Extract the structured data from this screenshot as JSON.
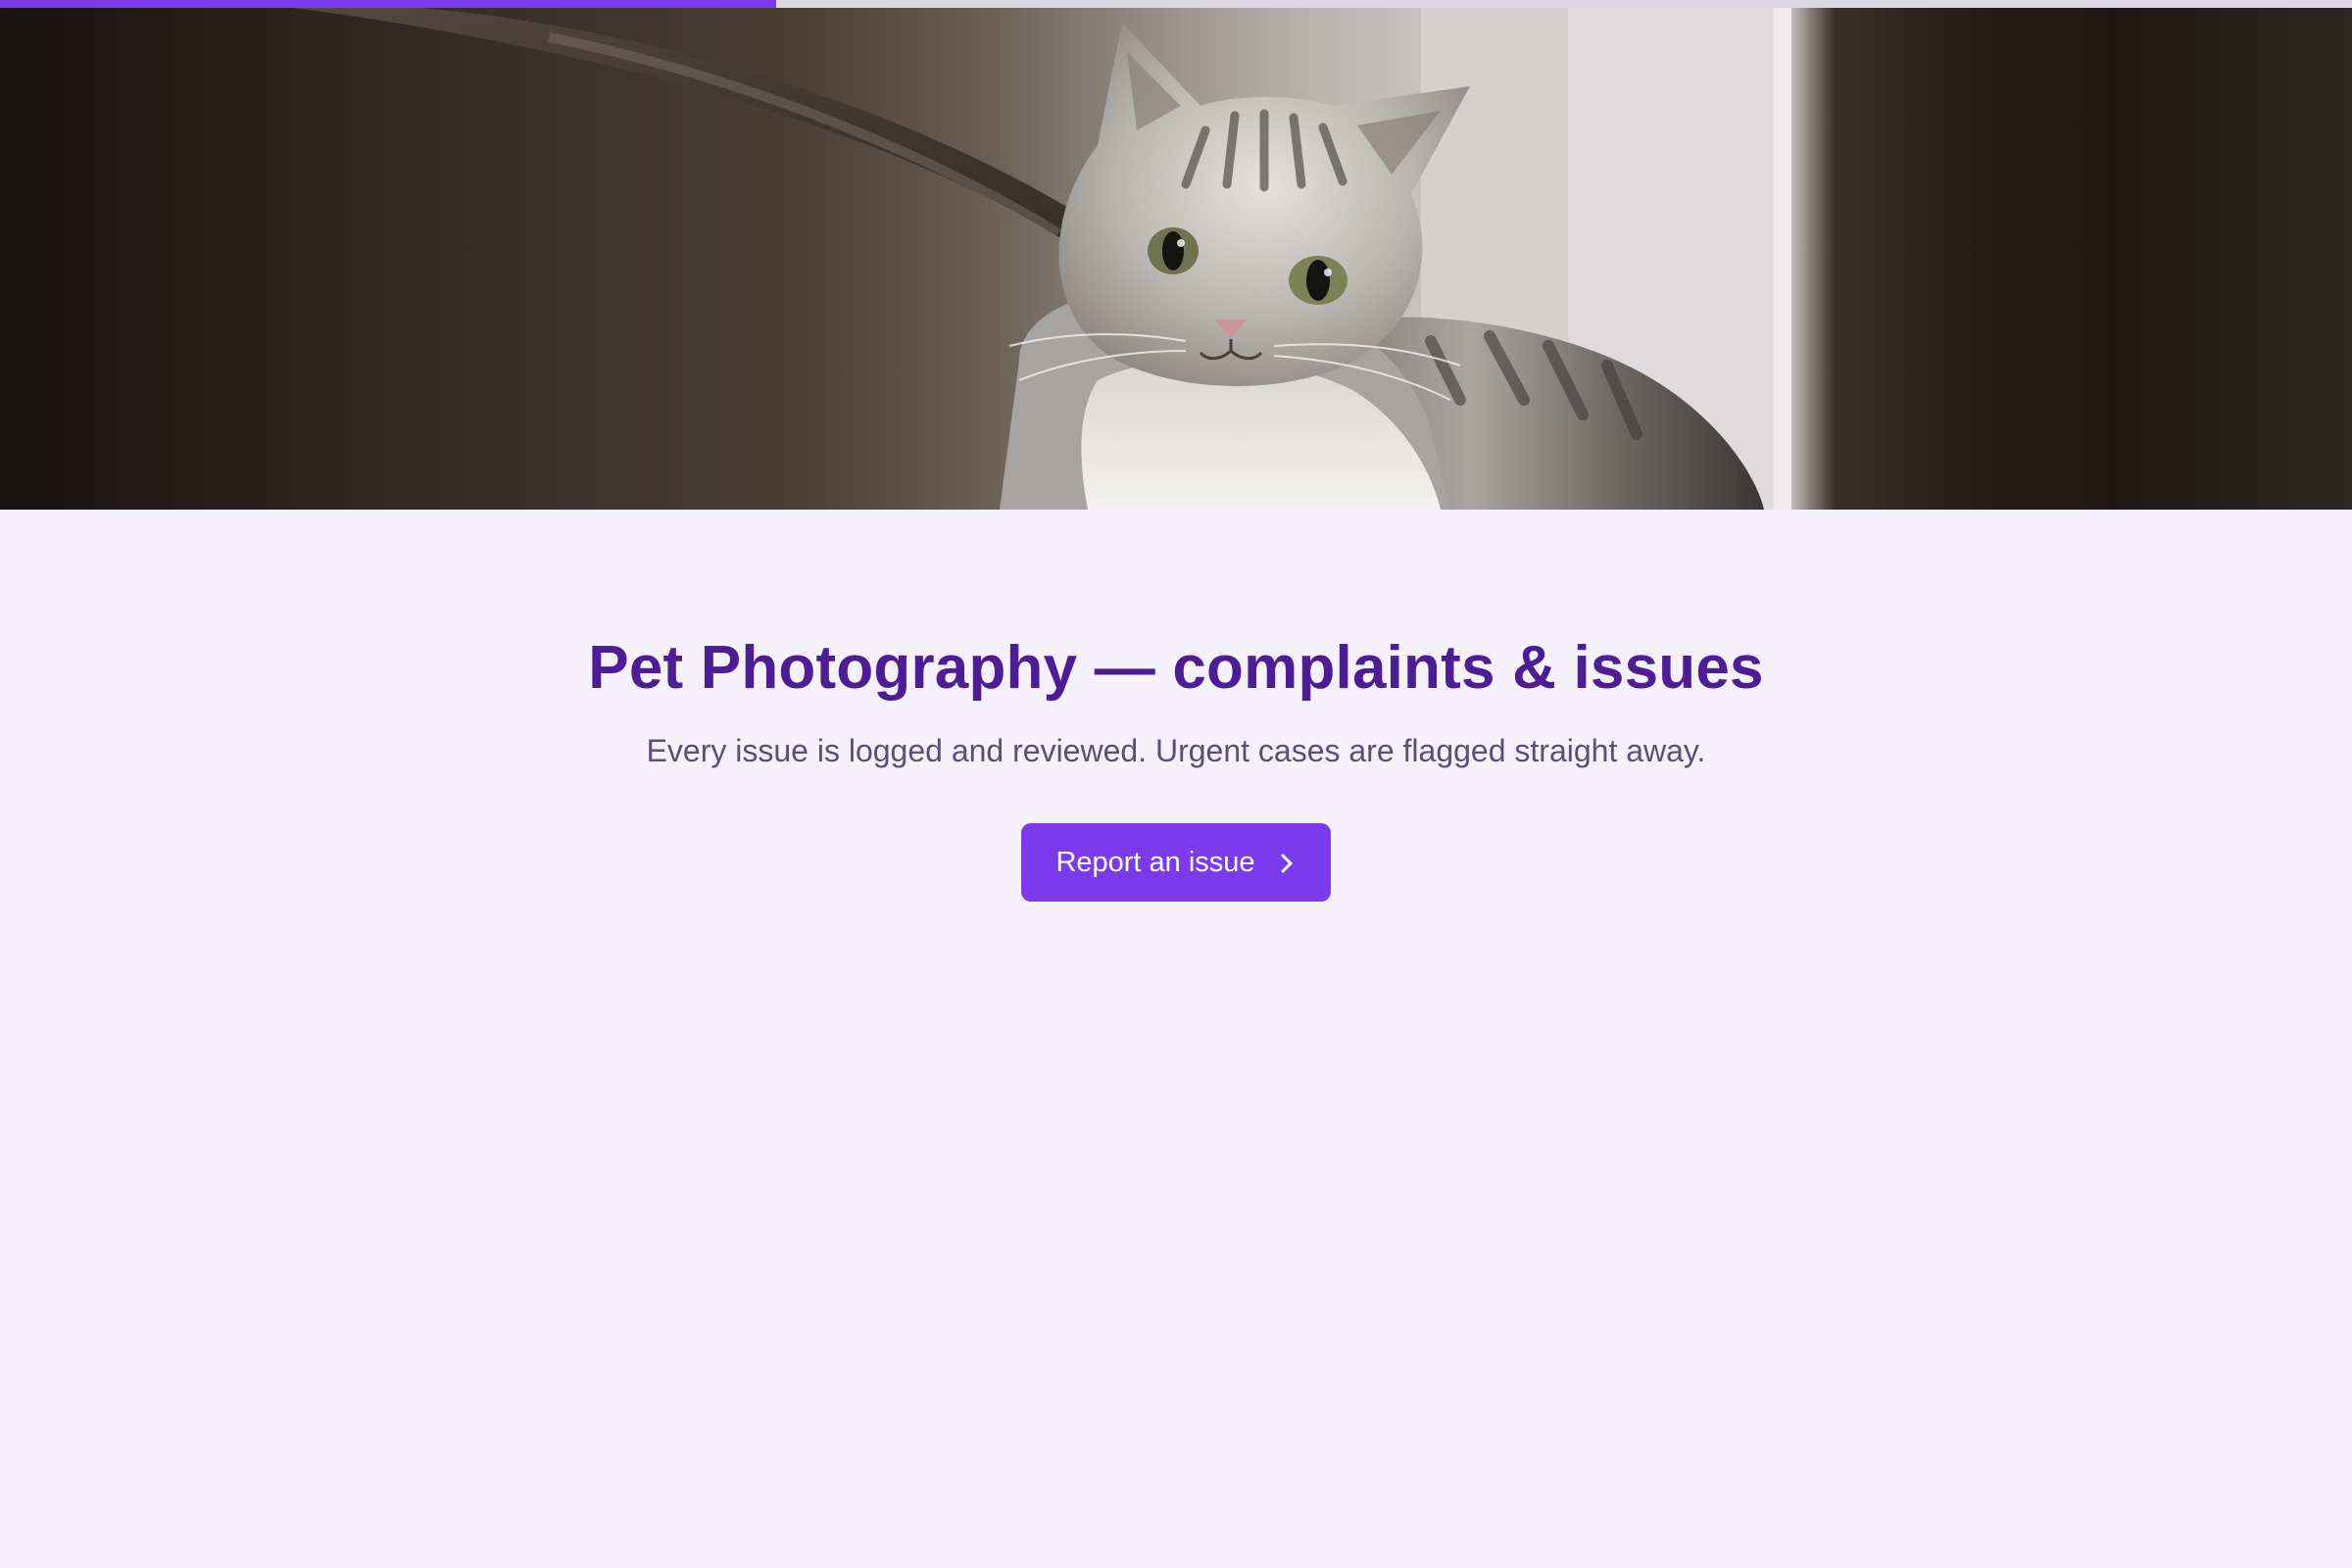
{
  "progress": {
    "fraction": 0.33,
    "fill_color": "#7c3aed",
    "track_color": "#dcd8e4"
  },
  "hero": {
    "image_subject": "grey-tabby-cat-photo"
  },
  "main": {
    "title": "Pet Photography — complaints & issues",
    "subtitle": "Every issue is logged and reviewed. Urgent cases are flagged straight away.",
    "cta_label": "Report an issue",
    "cta_icon": "chevron-right-icon"
  },
  "colors": {
    "accent": "#7c3aed",
    "title": "#4c1d95",
    "subtitle": "#5b4f78",
    "background": "#f5f2fd"
  }
}
